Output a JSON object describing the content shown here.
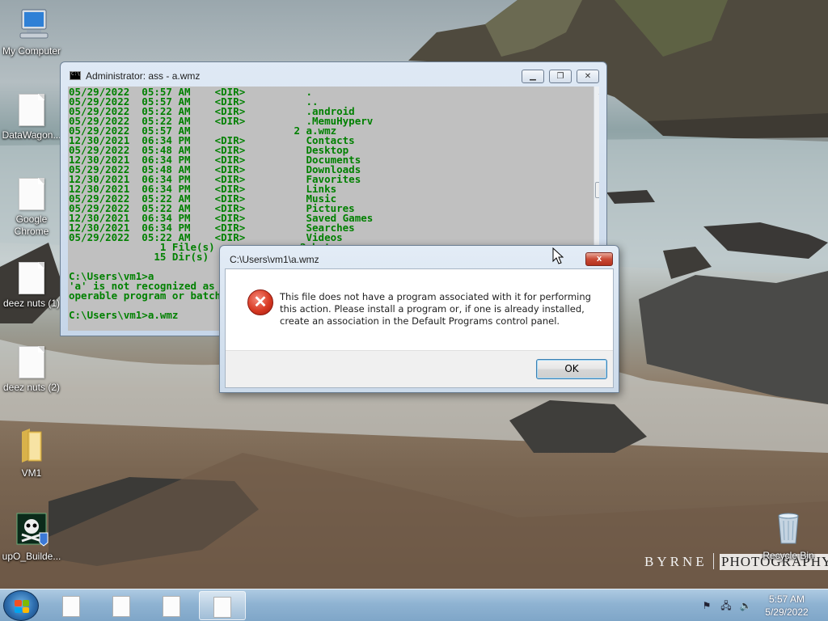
{
  "wallpaper": {
    "credit_left": "BYRNE",
    "credit_right": "PHOTOGRAPHY"
  },
  "desktop_icons": [
    {
      "label": "My Computer",
      "icon": "computer-icon"
    },
    {
      "label": "DataWagon...",
      "icon": "file-icon"
    },
    {
      "label": "Google Chrome",
      "icon": "file-icon"
    },
    {
      "label": "deez nuts (1)",
      "icon": "file-icon"
    },
    {
      "label": "deez nuts (2)",
      "icon": "file-icon"
    },
    {
      "label": "VM1",
      "icon": "folder-icon"
    },
    {
      "label": "upO_Builde...",
      "icon": "skull-app-icon"
    },
    {
      "label": "Recycle Bin",
      "icon": "recycle-bin-icon"
    }
  ],
  "console": {
    "title": "Administrator:  ass - a.wmz",
    "lines": [
      "05/29/2022  05:57 AM    <DIR>          .",
      "05/29/2022  05:57 AM    <DIR>          ..",
      "05/29/2022  05:22 AM    <DIR>          .android",
      "05/29/2022  05:22 AM    <DIR>          .MemuHyperv",
      "05/29/2022  05:57 AM                 2 a.wmz",
      "12/30/2021  06:34 PM    <DIR>          Contacts",
      "05/29/2022  05:48 AM    <DIR>          Desktop",
      "12/30/2021  06:34 PM    <DIR>          Documents",
      "05/29/2022  05:48 AM    <DIR>          Downloads",
      "12/30/2021  06:34 PM    <DIR>          Favorites",
      "12/30/2021  06:34 PM    <DIR>          Links",
      "05/29/2022  05:22 AM    <DIR>          Music",
      "05/29/2022  05:22 AM    <DIR>          Pictures",
      "12/30/2021  06:34 PM    <DIR>          Saved Games",
      "12/30/2021  06:34 PM    <DIR>          Searches",
      "05/29/2022  05:22 AM    <DIR>          Videos",
      "               1 File(s)              2 bytes",
      "              15 Dir(s)",
      "",
      "C:\\Users\\vm1>a",
      "'a' is not recognized as an internal or external command,",
      "operable program or batch file.",
      "",
      "C:\\Users\\vm1>a.wmz"
    ],
    "buttons": {
      "minimize": "▁",
      "restore": "❐",
      "close": "✕"
    }
  },
  "dialog": {
    "title": "C:\\Users\\vm1\\a.wmz",
    "message": "This file does not have a program associated with it for performing this action. Please install a program or, if one is already installed, create an association in the Default Programs control panel.",
    "ok_label": "OK",
    "close_label": "x",
    "icon": "error-icon"
  },
  "taskbar": {
    "start_icon": "windows-start-icon",
    "buttons": [
      {
        "icon": "file-icon",
        "active": false
      },
      {
        "icon": "file-icon",
        "active": false
      },
      {
        "icon": "file-icon",
        "active": false
      },
      {
        "icon": "file-icon",
        "active": true
      }
    ],
    "tray": {
      "icons": [
        "action-center-flag-icon",
        "network-icon",
        "volume-icon"
      ]
    },
    "clock": {
      "time": "5:57 AM",
      "date": "5/29/2022"
    }
  }
}
